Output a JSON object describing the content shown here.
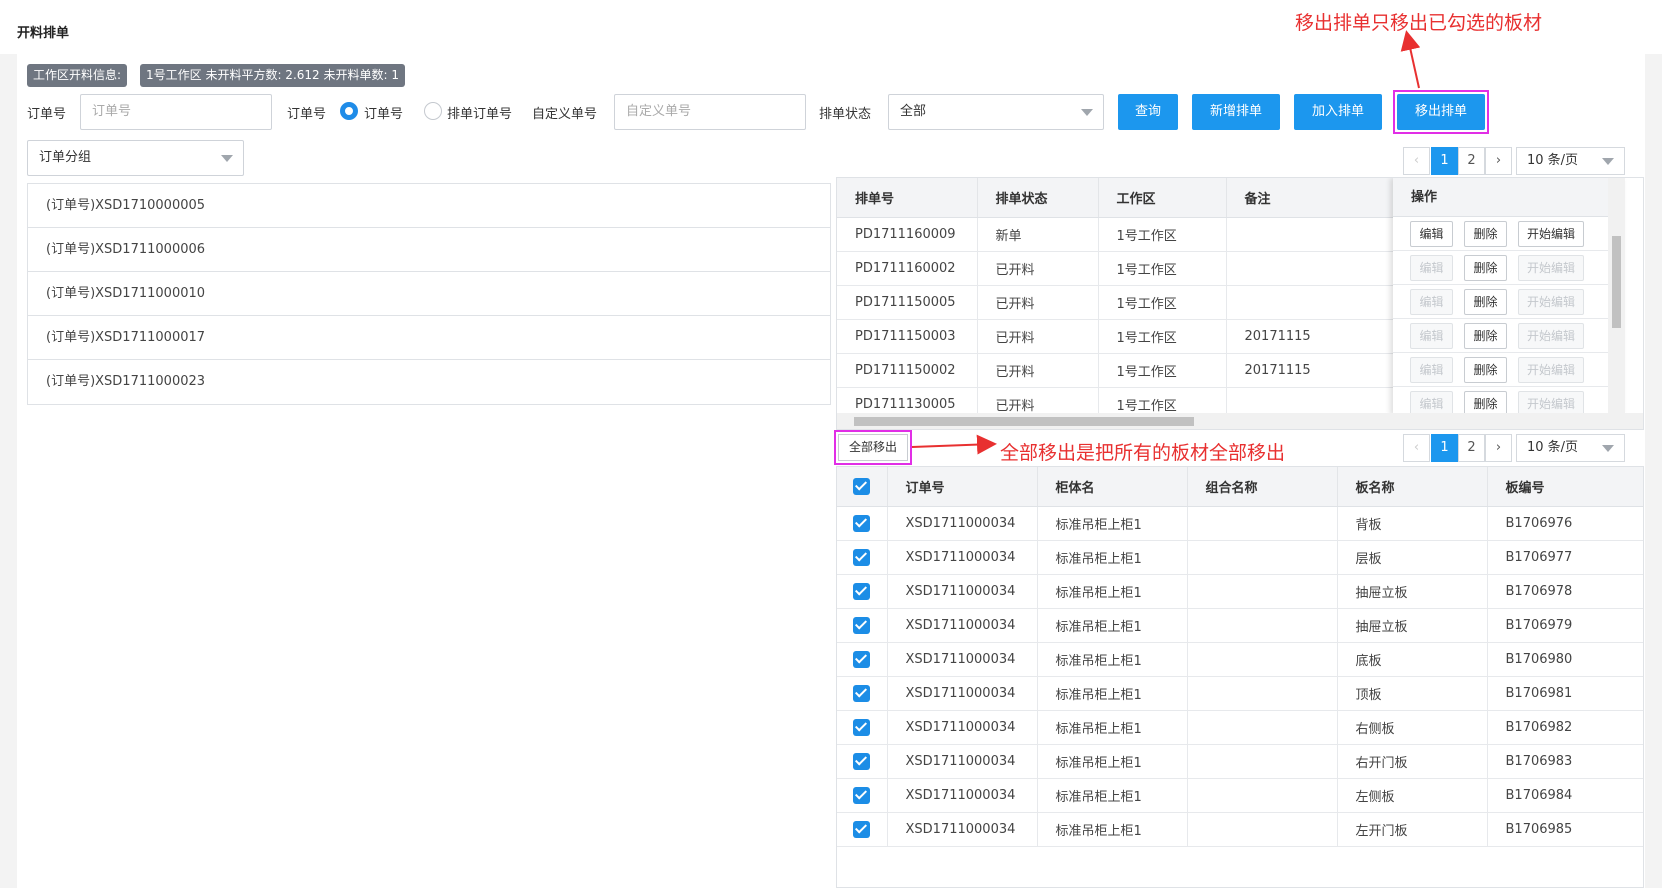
{
  "page": {
    "title": "开料排单"
  },
  "info": {
    "tag_label": "工作区开料信息:",
    "tag_value": "1号工作区 未开料平方数: 2.612 未开料单数: 1"
  },
  "search": {
    "order_label": "订单号",
    "order_placeholder": "订单号",
    "type_label": "订单号",
    "radio_order": "订单号",
    "radio_sched": "排单订单号",
    "custom_label": "自定义单号",
    "custom_placeholder": "自定义单号",
    "status_label": "排单状态",
    "status_value": "全部"
  },
  "buttons": {
    "query": "查询",
    "add_sched": "新增排单",
    "join_sched": "加入排单",
    "remove_sched": "移出排单",
    "remove_all": "全部移出"
  },
  "group": {
    "value": "订单分组"
  },
  "order_list": [
    "(订单号)XSD1710000005",
    "(订单号)XSD1711000006",
    "(订单号)XSD1711000010",
    "(订单号)XSD1711000017",
    "(订单号)XSD1711000023"
  ],
  "pager_top": {
    "pages": [
      "1",
      "2"
    ],
    "size": "10 条/页"
  },
  "pager_bottom": {
    "pages": [
      "1",
      "2"
    ],
    "size": "10 条/页"
  },
  "sched_table": {
    "headers": [
      "排单号",
      "排单状态",
      "工作区",
      "备注",
      "操作"
    ],
    "rows": [
      [
        "PD1711160009",
        "新单",
        "1号工作区",
        ""
      ],
      [
        "PD1711160002",
        "已开料",
        "1号工作区",
        ""
      ],
      [
        "PD1711150005",
        "已开料",
        "1号工作区",
        ""
      ],
      [
        "PD1711150003",
        "已开料",
        "1号工作区",
        "20171115"
      ],
      [
        "PD1711150002",
        "已开料",
        "1号工作区",
        "20171115"
      ],
      [
        "PD1711130005",
        "已开料",
        "1号工作区",
        ""
      ]
    ],
    "actions": {
      "edit": "编辑",
      "delete": "删除",
      "start_edit": "开始编辑"
    }
  },
  "board_table": {
    "headers": [
      "订单号",
      "柜体名",
      "组合名称",
      "板名称",
      "板编号"
    ],
    "rows": [
      [
        "XSD1711000034",
        "标准吊柜上柜1",
        "",
        "背板",
        "B1706976"
      ],
      [
        "XSD1711000034",
        "标准吊柜上柜1",
        "",
        "层板",
        "B1706977"
      ],
      [
        "XSD1711000034",
        "标准吊柜上柜1",
        "",
        "抽屉立板",
        "B1706978"
      ],
      [
        "XSD1711000034",
        "标准吊柜上柜1",
        "",
        "抽屉立板",
        "B1706979"
      ],
      [
        "XSD1711000034",
        "标准吊柜上柜1",
        "",
        "底板",
        "B1706980"
      ],
      [
        "XSD1711000034",
        "标准吊柜上柜1",
        "",
        "顶板",
        "B1706981"
      ],
      [
        "XSD1711000034",
        "标准吊柜上柜1",
        "",
        "右侧板",
        "B1706982"
      ],
      [
        "XSD1711000034",
        "标准吊柜上柜1",
        "",
        "右开门板",
        "B1706983"
      ],
      [
        "XSD1711000034",
        "标准吊柜上柜1",
        "",
        "左侧板",
        "B1706984"
      ],
      [
        "XSD1711000034",
        "标准吊柜上柜1",
        "",
        "左开门板",
        "B1706985"
      ]
    ]
  },
  "annotations": {
    "top": "移出排单只移出已勾选的板材",
    "bottom": "全部移出是把所有的板材全部移出"
  },
  "colors": {
    "accent": "#1c97ee",
    "highlight": "#e12ee6",
    "annotation": "#e83030"
  }
}
